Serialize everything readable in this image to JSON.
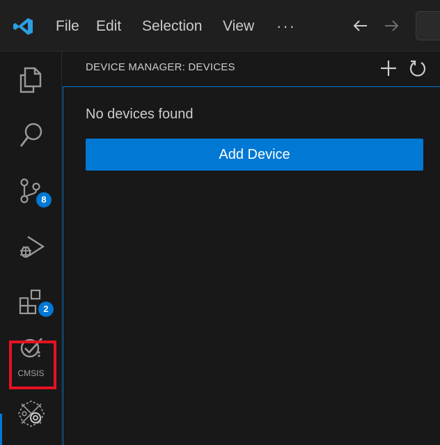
{
  "menu": {
    "items": [
      "File",
      "Edit",
      "Selection",
      "View"
    ],
    "more": "···"
  },
  "activity_bar": {
    "items": [
      {
        "name": "explorer",
        "icon": "files-icon"
      },
      {
        "name": "search",
        "icon": "search-icon"
      },
      {
        "name": "source-control",
        "icon": "source-control-icon",
        "badge": "8"
      },
      {
        "name": "run-and-debug",
        "icon": "run-debug-icon"
      },
      {
        "name": "extensions",
        "icon": "extensions-icon",
        "badge": "2"
      },
      {
        "name": "cmsis",
        "icon": "cmsis-icon",
        "label": "CMSIS"
      },
      {
        "name": "device-manager",
        "icon": "device-manager-icon"
      }
    ]
  },
  "panel": {
    "title": "DEVICE MANAGER: DEVICES",
    "empty_message": "No devices found",
    "add_device_label": "Add Device"
  },
  "colors": {
    "accent": "#0078d4",
    "highlight": "#e81123",
    "background": "#181818"
  }
}
